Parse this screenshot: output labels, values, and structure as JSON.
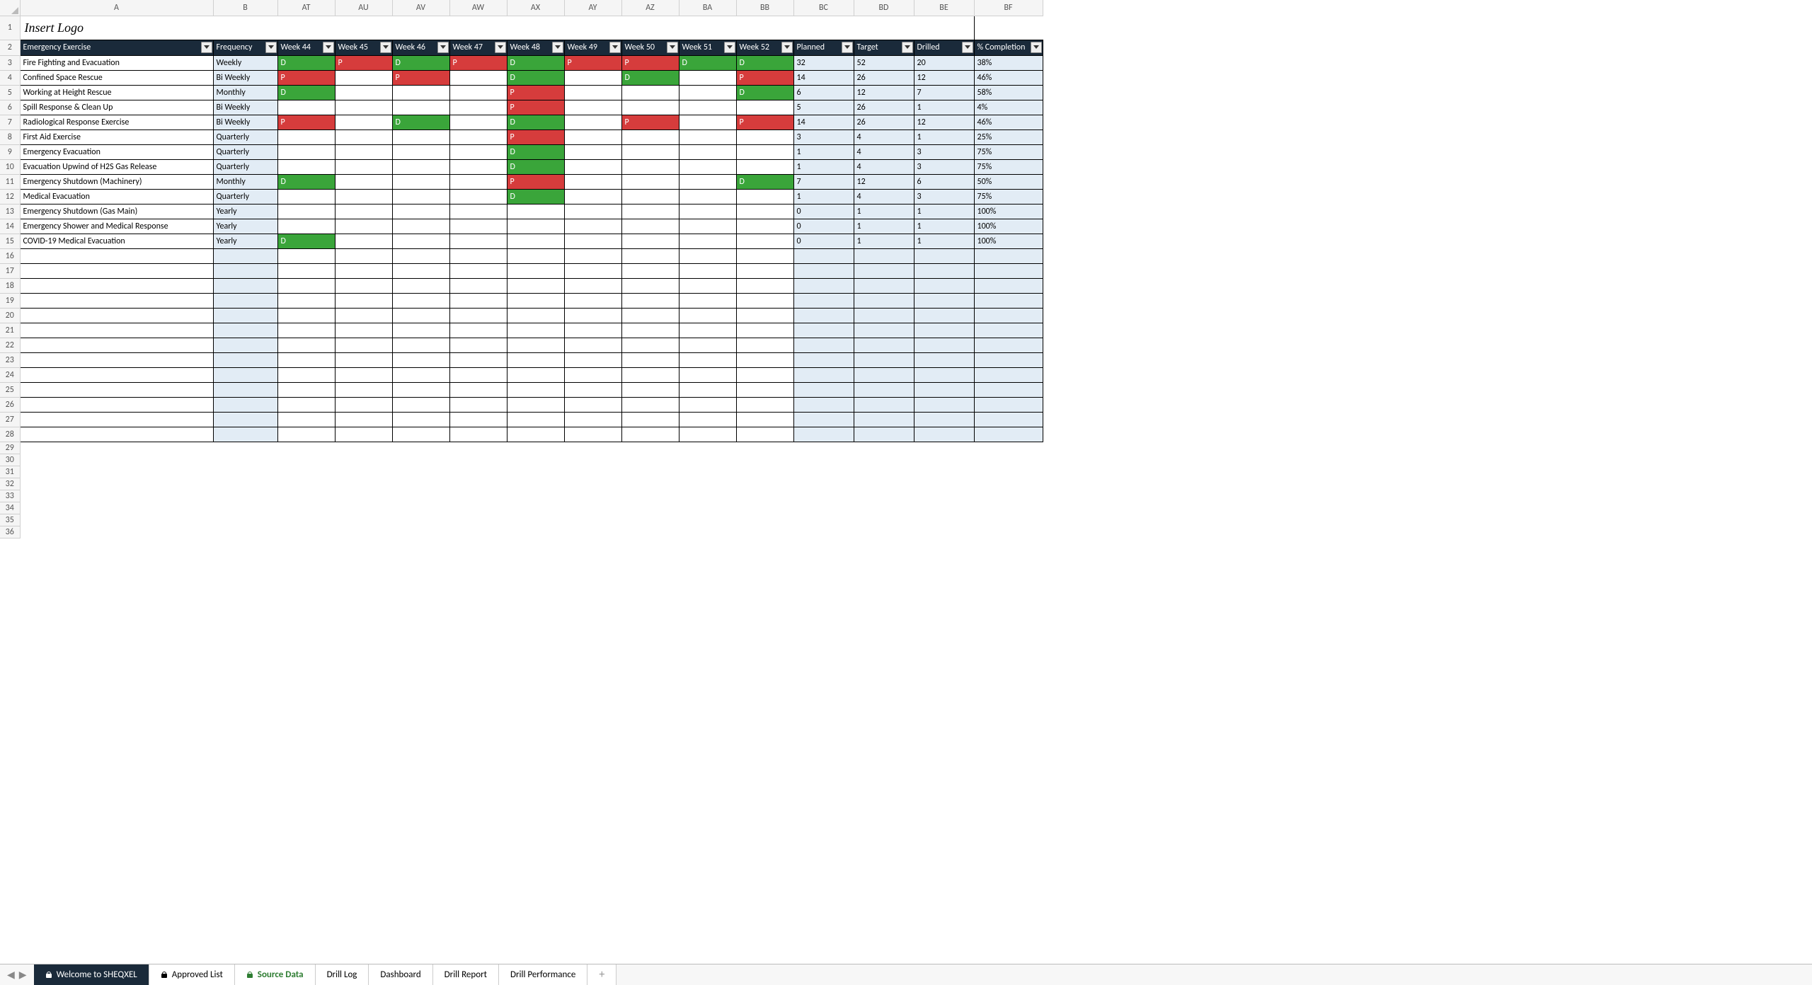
{
  "columns_letters": [
    "A",
    "B",
    "AT",
    "AU",
    "AV",
    "AW",
    "AX",
    "AY",
    "AZ",
    "BA",
    "BB",
    "BC",
    "BD",
    "BE",
    "BF"
  ],
  "title": "Insert Logo",
  "headers": [
    "Emergency Exercise",
    "Frequency",
    "Week 44",
    "Week 45",
    "Week 46",
    "Week 47",
    "Week 48",
    "Week 49",
    "Week 50",
    "Week 51",
    "Week 52",
    "Planned",
    "Target",
    "Drilled",
    "% Completion"
  ],
  "rows": [
    {
      "exercise": "Fire Fighting and Evacuation",
      "freq": "Weekly",
      "weeks": [
        "D",
        "P",
        "D",
        "P",
        "D",
        "P",
        "P",
        "D",
        "D"
      ],
      "planned": "32",
      "target": "52",
      "drilled": "20",
      "pct": "38%"
    },
    {
      "exercise": "Confined Space Rescue",
      "freq": "Bi Weekly",
      "weeks": [
        "P",
        "",
        "P",
        "",
        "D",
        "",
        "D",
        "",
        "P"
      ],
      "planned": "14",
      "target": "26",
      "drilled": "12",
      "pct": "46%"
    },
    {
      "exercise": "Working at Height Rescue",
      "freq": "Monthly",
      "weeks": [
        "D",
        "",
        "",
        "",
        "P",
        "",
        "",
        "",
        "D"
      ],
      "planned": "6",
      "target": "12",
      "drilled": "7",
      "pct": "58%"
    },
    {
      "exercise": "Spill Response & Clean Up",
      "freq": "Bi Weekly",
      "weeks": [
        "",
        "",
        "",
        "",
        "P",
        "",
        "",
        "",
        ""
      ],
      "planned": "5",
      "target": "26",
      "drilled": "1",
      "pct": "4%"
    },
    {
      "exercise": "Radiological Response Exercise",
      "freq": "Bi Weekly",
      "weeks": [
        "P",
        "",
        "D",
        "",
        "D",
        "",
        "P",
        "",
        "P"
      ],
      "planned": "14",
      "target": "26",
      "drilled": "12",
      "pct": "46%"
    },
    {
      "exercise": "First Aid Exercise",
      "freq": "Quarterly",
      "weeks": [
        "",
        "",
        "",
        "",
        "P",
        "",
        "",
        "",
        ""
      ],
      "planned": "3",
      "target": "4",
      "drilled": "1",
      "pct": "25%"
    },
    {
      "exercise": "Emergency Evacuation",
      "freq": "Quarterly",
      "weeks": [
        "",
        "",
        "",
        "",
        "D",
        "",
        "",
        "",
        ""
      ],
      "planned": "1",
      "target": "4",
      "drilled": "3",
      "pct": "75%"
    },
    {
      "exercise": "Evacuation Upwind of H2S Gas Release",
      "freq": "Quarterly",
      "weeks": [
        "",
        "",
        "",
        "",
        "D",
        "",
        "",
        "",
        ""
      ],
      "planned": "1",
      "target": "4",
      "drilled": "3",
      "pct": "75%"
    },
    {
      "exercise": "Emergency Shutdown (Machinery)",
      "freq": "Monthly",
      "weeks": [
        "D",
        "",
        "",
        "",
        "P",
        "",
        "",
        "",
        "D"
      ],
      "planned": "7",
      "target": "12",
      "drilled": "6",
      "pct": "50%"
    },
    {
      "exercise": "Medical Evacuation",
      "freq": "Quarterly",
      "weeks": [
        "",
        "",
        "",
        "",
        "D",
        "",
        "",
        "",
        ""
      ],
      "planned": "1",
      "target": "4",
      "drilled": "3",
      "pct": "75%"
    },
    {
      "exercise": "Emergency Shutdown (Gas Main)",
      "freq": "Yearly",
      "weeks": [
        "",
        "",
        "",
        "",
        "",
        "",
        "",
        "",
        ""
      ],
      "planned": "0",
      "target": "1",
      "drilled": "1",
      "pct": "100%"
    },
    {
      "exercise": "Emergency Shower and Medical Response",
      "freq": "Yearly",
      "weeks": [
        "",
        "",
        "",
        "",
        "",
        "",
        "",
        "",
        ""
      ],
      "planned": "0",
      "target": "1",
      "drilled": "1",
      "pct": "100%"
    },
    {
      "exercise": "COVID-19 Medical Evacuation",
      "freq": "Yearly",
      "weeks": [
        "D",
        "",
        "",
        "",
        "",
        "",
        "",
        "",
        ""
      ],
      "planned": "0",
      "target": "1",
      "drilled": "1",
      "pct": "100%"
    }
  ],
  "empty_rows_full_border": [
    16,
    17,
    18,
    19,
    20,
    21,
    22,
    23,
    24,
    25,
    26,
    27,
    28
  ],
  "thin_rows": [
    29,
    30,
    31,
    32,
    33,
    34,
    35,
    36
  ],
  "tabs": [
    {
      "label": "Welcome to SHEQXEL",
      "locked": true,
      "style": "active-dark"
    },
    {
      "label": "Approved List",
      "locked": true,
      "style": ""
    },
    {
      "label": "Source Data",
      "locked": true,
      "style": "active-green"
    },
    {
      "label": "Drill Log",
      "locked": false,
      "style": ""
    },
    {
      "label": "Dashboard",
      "locked": false,
      "style": ""
    },
    {
      "label": "Drill Report",
      "locked": false,
      "style": ""
    },
    {
      "label": "Drill Performance",
      "locked": false,
      "style": ""
    }
  ]
}
